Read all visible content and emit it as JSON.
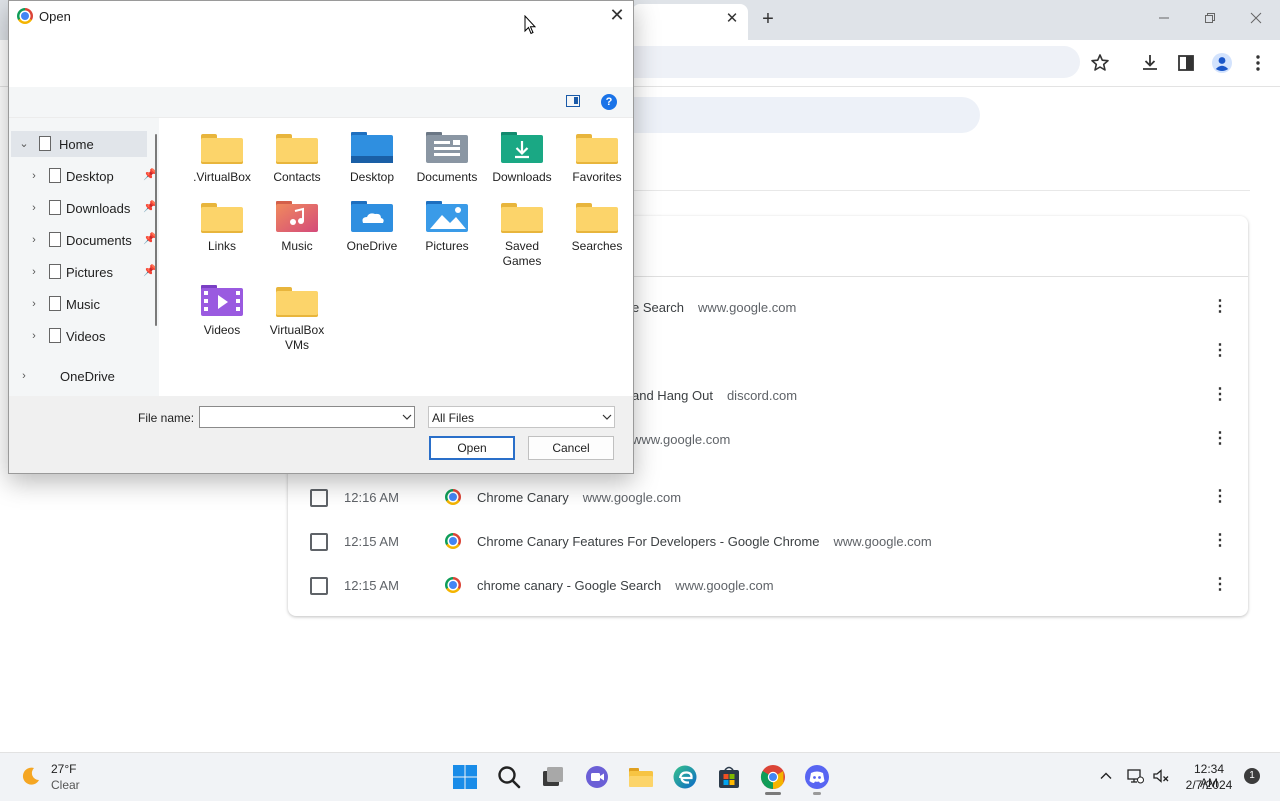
{
  "chrome": {
    "tab_close": "✕",
    "new_tab": "+",
    "partial_rows": [
      {
        "title": "e Search",
        "domain": "www.google.com"
      },
      {
        "title": "and Hang Out",
        "domain": "discord.com"
      },
      {
        "title": "",
        "domain": "www.google.com"
      }
    ],
    "history_rows": [
      {
        "time": "12:16 AM",
        "title": "Chrome Canary",
        "domain": "www.google.com"
      },
      {
        "time": "12:15 AM",
        "title": "Chrome Canary Features For Developers - Google Chrome",
        "domain": "www.google.com"
      },
      {
        "time": "12:15 AM",
        "title": "chrome canary - Google Search",
        "domain": "www.google.com"
      }
    ],
    "more_glyph": "⋮"
  },
  "dialog": {
    "title": "Open",
    "close": "✕",
    "help": "?",
    "nav": [
      {
        "label": "Home",
        "chev": "⌄",
        "selected": true
      },
      {
        "label": "Desktop",
        "chev": "›",
        "pinned": true
      },
      {
        "label": "Downloads",
        "chev": "›",
        "pinned": true
      },
      {
        "label": "Documents",
        "chev": "›",
        "pinned": true
      },
      {
        "label": "Pictures",
        "chev": "›",
        "pinned": true
      },
      {
        "label": "Music",
        "chev": "›"
      },
      {
        "label": "Videos",
        "chev": "›"
      },
      {
        "label": "OneDrive",
        "chev": "›"
      }
    ],
    "items": [
      {
        "name": ".VirtualBox",
        "icon": "folder-icon"
      },
      {
        "name": "Contacts",
        "icon": "contacts-folder-icon"
      },
      {
        "name": "Desktop",
        "icon": "desktop-folder-icon"
      },
      {
        "name": "Documents",
        "icon": "documents-folder-icon"
      },
      {
        "name": "Downloads",
        "icon": "downloads-folder-icon"
      },
      {
        "name": "Favorites",
        "icon": "favorites-folder-icon"
      },
      {
        "name": "Links",
        "icon": "links-folder-icon"
      },
      {
        "name": "Music",
        "icon": "music-folder-icon"
      },
      {
        "name": "OneDrive",
        "icon": "onedrive-folder-icon"
      },
      {
        "name": "Pictures",
        "icon": "pictures-folder-icon"
      },
      {
        "name": "Saved Games",
        "icon": "saved-games-folder-icon"
      },
      {
        "name": "Searches",
        "icon": "searches-folder-icon"
      },
      {
        "name": "Videos",
        "icon": "videos-folder-icon"
      },
      {
        "name": "VirtualBox VMs",
        "icon": "folder-icon"
      }
    ],
    "filename_label": "File name:",
    "filename_value": "",
    "filetype": "All Files",
    "open_label": "Open",
    "cancel_label": "Cancel"
  },
  "taskbar": {
    "temp": "27°F",
    "condition": "Clear",
    "time": "12:34 AM",
    "date": "2/7/2024",
    "notifications": "1"
  }
}
